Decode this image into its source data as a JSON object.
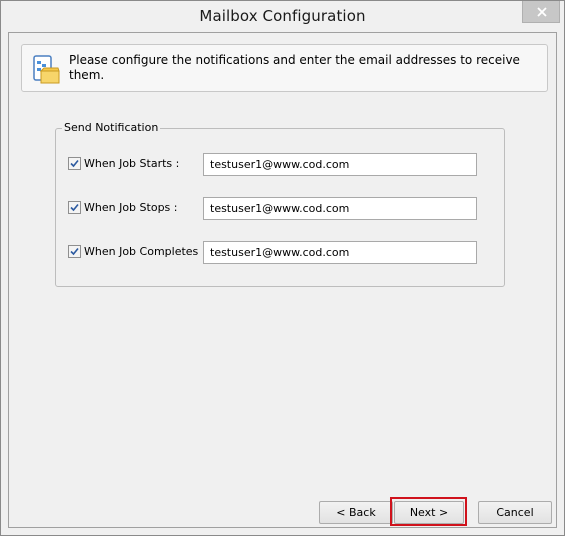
{
  "window": {
    "title": "Mailbox Configuration"
  },
  "banner": {
    "text": "Please configure the notifications and enter the email addresses to receive them."
  },
  "group": {
    "legend": "Send Notification",
    "rows": [
      {
        "label": "When Job Starts :",
        "checked": true,
        "email": "testuser1@www.cod.com"
      },
      {
        "label": "When Job Stops :",
        "checked": true,
        "email": "testuser1@www.cod.com"
      },
      {
        "label": "When Job Completes :",
        "checked": true,
        "email": "testuser1@www.cod.com"
      }
    ]
  },
  "buttons": {
    "back": "< Back",
    "next": "Next >",
    "cancel": "Cancel"
  },
  "colors": {
    "highlight": "#d0121c",
    "background": "#f0f0f0"
  },
  "icons": {
    "close": "close-icon",
    "banner": "mailbox-config-icon",
    "check": "checkmark-icon"
  }
}
